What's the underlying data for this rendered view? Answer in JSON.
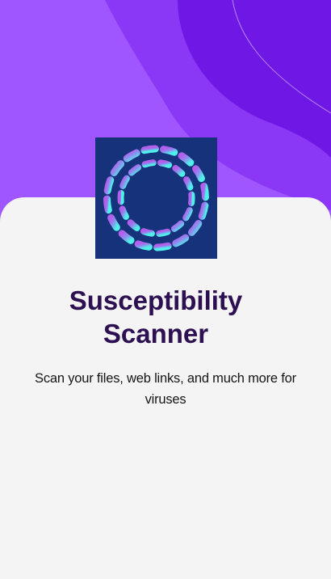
{
  "onboarding": {
    "title_line1": "Susceptibility",
    "title_line2": "Scanner",
    "description": "Scan your files, web links, and much more for viruses"
  },
  "logo": {
    "icon": "scanner-rings-icon",
    "background_color": "#16327a"
  },
  "colors": {
    "hero_light": "#a056ff",
    "hero_mid": "#8a38f5",
    "hero_dark": "#6f18e6",
    "card_background": "#f4f4f4",
    "title_color": "#2c1052"
  }
}
